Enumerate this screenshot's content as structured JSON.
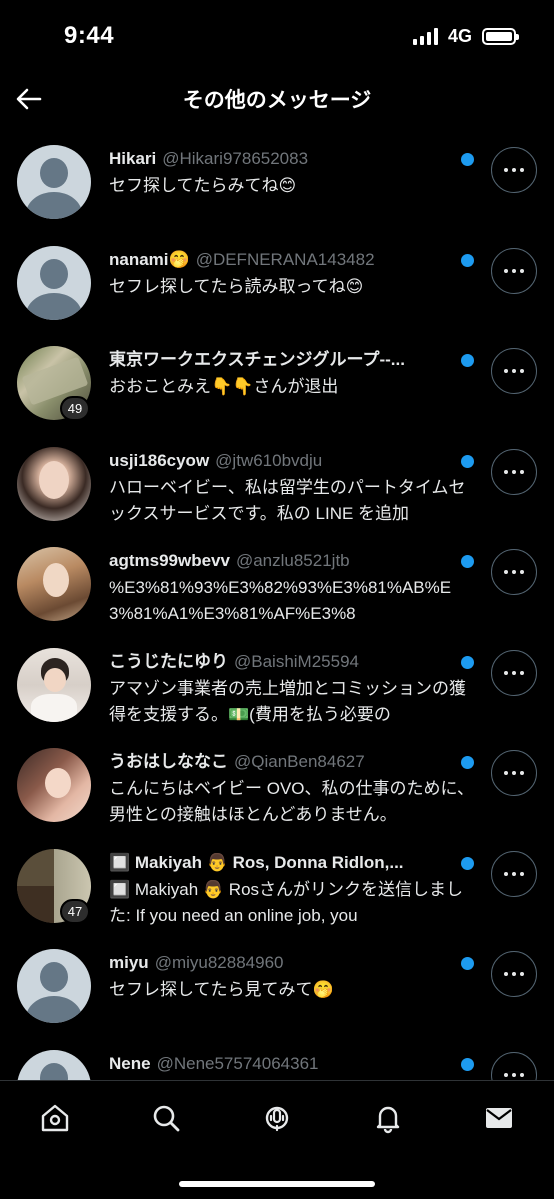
{
  "status": {
    "time": "9:44",
    "network": "4G"
  },
  "header": {
    "title": "その他のメッセージ"
  },
  "messages": [
    {
      "name": "Hikari",
      "handle": "@Hikari978652083",
      "preview": "セフ探してたらみてね😊",
      "avatar": "default",
      "badge": ""
    },
    {
      "name": "nanami🤭",
      "handle": "@DEFNERANA143482",
      "preview": "セフレ探してたら読み取ってね😊",
      "avatar": "default",
      "badge": ""
    },
    {
      "name": "東京ワークエクスチェンジグループ--...",
      "handle": "",
      "preview": "おおことみえ👇👇さんが退出",
      "avatar": "photo",
      "badge": "49"
    },
    {
      "name": "usji186cyow",
      "handle": "@jtw610bvdju",
      "preview": "ハローベイビー、私は留学生のパートタイムセックスサービスです。私の LINE を追加",
      "avatar": "photo",
      "badge": ""
    },
    {
      "name": "agtms99wbevv",
      "handle": "@anzlu8521jtb",
      "preview": "%E3%81%93%E3%82%93%E3%81%AB%E3%81%A1%E3%81%AF%E3%8",
      "avatar": "photo",
      "badge": ""
    },
    {
      "name": "こうじたにゆり",
      "handle": "@BaishiM25594",
      "preview": "アマゾン事業者の売上増加とコミッションの獲得を支援する。💵(費用を払う必要の",
      "avatar": "photo",
      "badge": ""
    },
    {
      "name": "うおはしななこ",
      "handle": "@QianBen84627",
      "preview": "こんにちはベイビー OVO、私の仕事のために、男性との接触はほとんどありません。",
      "avatar": "photo",
      "badge": ""
    },
    {
      "name": "🔲 Makiyah 👨 Ros, Donna Ridlon,...",
      "handle": "",
      "preview": "🔲 Makiyah 👨 Rosさんがリンクを送信しました: If you need an online job, you",
      "avatar": "photo",
      "badge": "47"
    },
    {
      "name": "miyu",
      "handle": "@miyu82884960",
      "preview": "セフレ探してたら見てみて🤭",
      "avatar": "default",
      "badge": ""
    },
    {
      "name": "Nene",
      "handle": "@Nene57574064361",
      "preview": "",
      "avatar": "default",
      "badge": ""
    }
  ],
  "tabbar": {
    "icons": [
      "home-icon",
      "search-icon",
      "spaces-icon",
      "notifications-icon",
      "messages-icon"
    ]
  },
  "colors": {
    "accent": "#1d9bf0",
    "background": "#000000",
    "secondary_text": "#71767b"
  }
}
